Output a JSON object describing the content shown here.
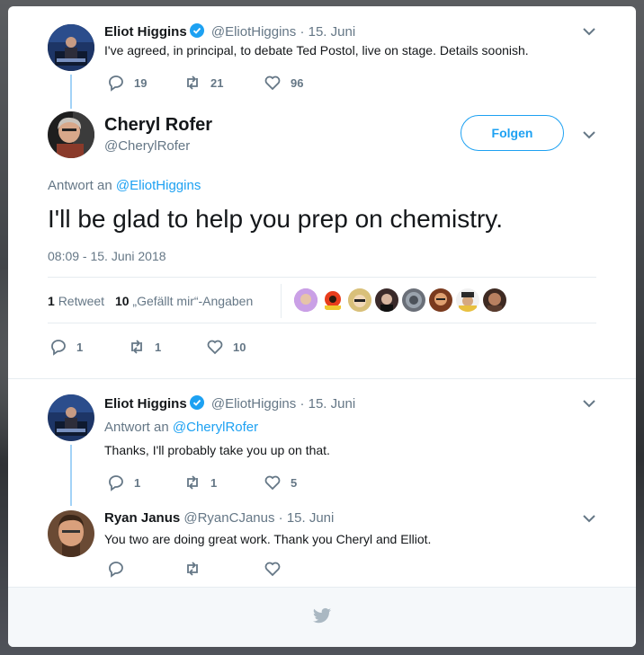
{
  "tweets": {
    "t1": {
      "name": "Eliot Higgins",
      "handle": "@EliotHiggins",
      "date": "· 15. Juni",
      "text": "I've agreed, in principal, to debate Ted Postol, live on stage. Details soonish.",
      "replies": "19",
      "retweets": "21",
      "likes": "96"
    },
    "main": {
      "name": "Cheryl Rofer",
      "handle": "@CherylRofer",
      "follow_label": "Folgen",
      "reply_prefix": "Antwort an",
      "reply_to": "@EliotHiggins",
      "text": "I'll be glad to help you prep on chemistry.",
      "timestamp": "08:09 - 15. Juni 2018",
      "retweet_count": "1",
      "retweet_label": "Retweet",
      "like_count": "10",
      "like_label": "„Gefällt mir“-Angaben",
      "replies": "1",
      "retweets": "1",
      "likes": "10"
    },
    "t3": {
      "name": "Eliot Higgins",
      "handle": "@EliotHiggins",
      "date": "· 15. Juni",
      "reply_prefix": "Antwort an",
      "reply_to": "@CherylRofer",
      "text": "Thanks, I'll probably take you up on that.",
      "replies": "1",
      "retweets": "1",
      "likes": "5"
    },
    "t4": {
      "name": "Ryan Janus",
      "handle": "@RyanCJanus",
      "date": "· 15. Juni",
      "text": "You two are doing great work.  Thank you Cheryl and Elliot."
    }
  },
  "colors": {
    "accent": "#1da1f2",
    "text": "#14171a",
    "muted": "#657786",
    "like_heart": "#657786"
  },
  "icons": [
    "reply-icon",
    "retweet-icon",
    "like-icon",
    "verified-icon",
    "chevron-down-icon",
    "twitter-bird-icon"
  ]
}
